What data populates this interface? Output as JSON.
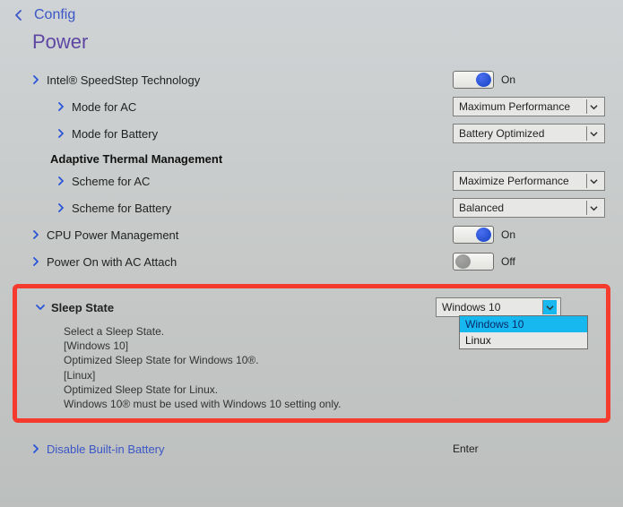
{
  "breadcrumb": "Config",
  "page_title": "Power",
  "speedstep": {
    "label": "Intel® SpeedStep Technology",
    "state": "On",
    "mode_ac": {
      "label": "Mode for AC",
      "value": "Maximum Performance"
    },
    "mode_bat": {
      "label": "Mode for Battery",
      "value": "Battery Optimized"
    }
  },
  "thermal": {
    "heading": "Adaptive Thermal Management",
    "scheme_ac": {
      "label": "Scheme for AC",
      "value": "Maximize Performance"
    },
    "scheme_bat": {
      "label": "Scheme for Battery",
      "value": "Balanced"
    }
  },
  "cpu_power": {
    "label": "CPU Power Management",
    "state": "On"
  },
  "ac_attach": {
    "label": "Power On with AC Attach",
    "state": "Off"
  },
  "sleep": {
    "label": "Sleep State",
    "value": "Windows 10",
    "options": [
      "Windows 10",
      "Linux"
    ],
    "desc_l1": "Select a Sleep State.",
    "desc_l2": "[Windows 10]",
    "desc_l3": "Optimized Sleep State for Windows 10®.",
    "desc_l4": "[Linux]",
    "desc_l5": "Optimized Sleep State for Linux.",
    "desc_l6": "Windows 10® must be used with Windows 10 setting only."
  },
  "battery": {
    "label": "Disable Built-in Battery",
    "action": "Enter"
  }
}
